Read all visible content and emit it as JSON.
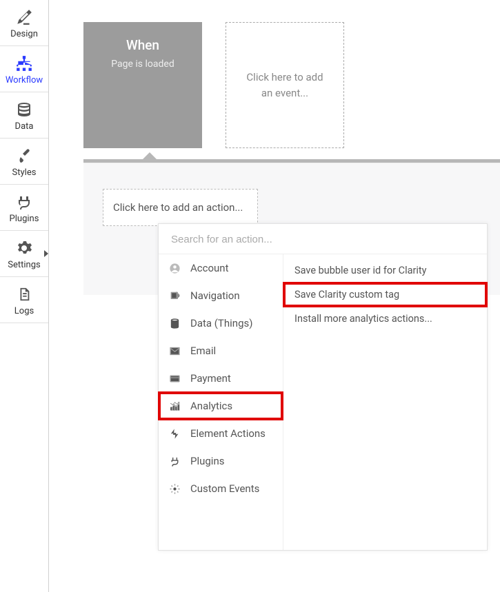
{
  "sidebar": {
    "items": [
      {
        "label": "Design"
      },
      {
        "label": "Workflow"
      },
      {
        "label": "Data"
      },
      {
        "label": "Styles"
      },
      {
        "label": "Plugins"
      },
      {
        "label": "Settings"
      },
      {
        "label": "Logs"
      }
    ]
  },
  "event": {
    "title": "When",
    "subtitle": "Page is loaded"
  },
  "event_placeholder": "Click here to add an event...",
  "add_action_label": "Click here to add an action...",
  "action_search_placeholder": "Search for an action...",
  "categories": [
    {
      "label": "Account"
    },
    {
      "label": "Navigation"
    },
    {
      "label": "Data (Things)"
    },
    {
      "label": "Email"
    },
    {
      "label": "Payment"
    },
    {
      "label": "Analytics"
    },
    {
      "label": "Element Actions"
    },
    {
      "label": "Plugins"
    },
    {
      "label": "Custom Events"
    }
  ],
  "actions": [
    {
      "label": "Save bubble user id for Clarity"
    },
    {
      "label": "Save Clarity custom tag"
    },
    {
      "label": "Install more analytics actions..."
    }
  ],
  "colors": {
    "highlight": "#e00000",
    "accent": "#2a3aff"
  }
}
